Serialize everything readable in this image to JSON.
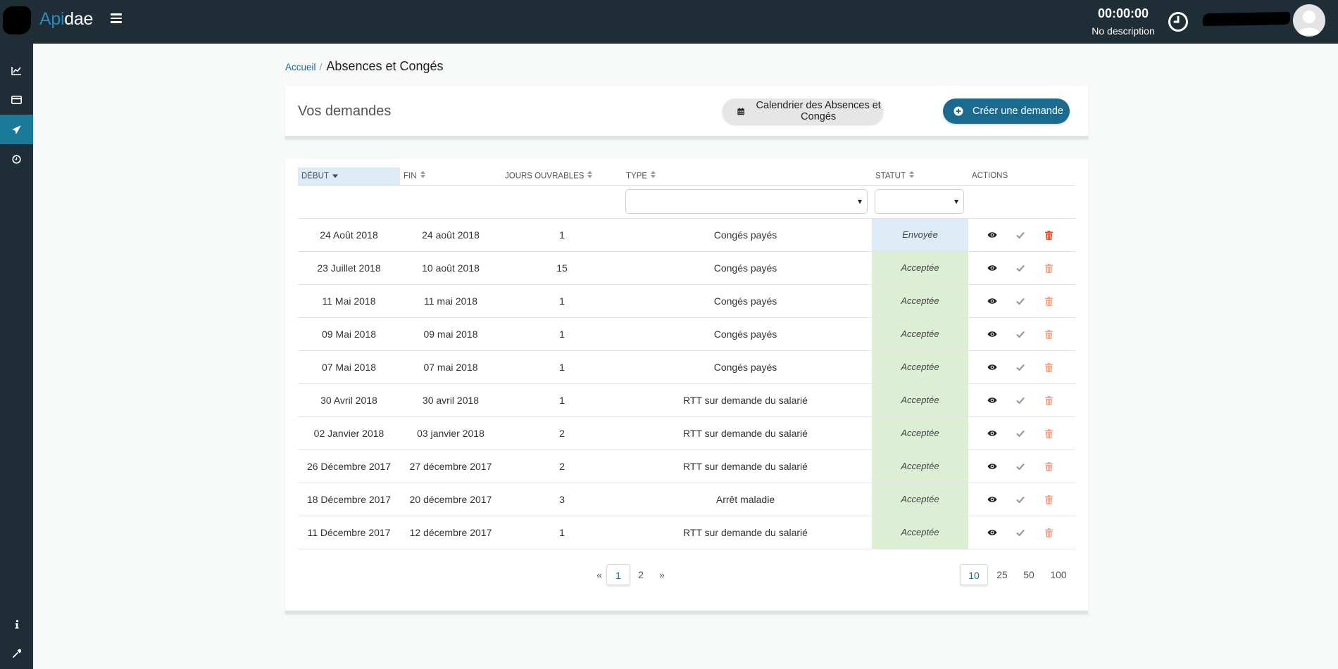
{
  "app": {
    "logo_part1": "Api",
    "logo_part2": "dae"
  },
  "topbar": {
    "timer": "00:00:00",
    "timer_desc": "No description"
  },
  "sidebar": {
    "items": [
      {
        "icon": "chart-line-icon"
      },
      {
        "icon": "credit-card-icon"
      },
      {
        "icon": "plane-icon",
        "active": true
      },
      {
        "icon": "clock-icon"
      }
    ],
    "bottom": [
      {
        "icon": "info-icon"
      },
      {
        "icon": "eyedropper-icon"
      }
    ]
  },
  "breadcrumb": {
    "home": "Accueil",
    "current": "Absences et Congés"
  },
  "header": {
    "title": "Vos demandes",
    "calendar_button": "Calendrier des Absences et Congés",
    "create_button": "Créer une demande"
  },
  "table": {
    "columns": {
      "debut": "Début",
      "fin": "Fin",
      "jours": "Jours ouvrables",
      "type": "Type",
      "statut": "Statut",
      "actions": "Actions"
    },
    "rows": [
      {
        "debut": "24 Août 2018",
        "fin": "24 août 2018",
        "jours": "1",
        "type": "Congés payés",
        "statut": "Envoyée",
        "status_class": "envoyee"
      },
      {
        "debut": "23 Juillet 2018",
        "fin": "10 août 2018",
        "jours": "15",
        "type": "Congés payés",
        "statut": "Acceptée",
        "status_class": "acceptee"
      },
      {
        "debut": "11 Mai 2018",
        "fin": "11 mai 2018",
        "jours": "1",
        "type": "Congés payés",
        "statut": "Acceptée",
        "status_class": "acceptee"
      },
      {
        "debut": "09 Mai 2018",
        "fin": "09 mai 2018",
        "jours": "1",
        "type": "Congés payés",
        "statut": "Acceptée",
        "status_class": "acceptee"
      },
      {
        "debut": "07 Mai 2018",
        "fin": "07 mai 2018",
        "jours": "1",
        "type": "Congés payés",
        "statut": "Acceptée",
        "status_class": "acceptee"
      },
      {
        "debut": "30 Avril 2018",
        "fin": "30 avril 2018",
        "jours": "1",
        "type": "RTT sur demande du salarié",
        "statut": "Acceptée",
        "status_class": "acceptee"
      },
      {
        "debut": "02 Janvier 2018",
        "fin": "03 janvier 2018",
        "jours": "2",
        "type": "RTT sur demande du salarié",
        "statut": "Acceptée",
        "status_class": "acceptee"
      },
      {
        "debut": "26 Décembre 2017",
        "fin": "27 décembre 2017",
        "jours": "2",
        "type": "RTT sur demande du salarié",
        "statut": "Acceptée",
        "status_class": "acceptee"
      },
      {
        "debut": "18 Décembre 2017",
        "fin": "20 décembre 2017",
        "jours": "3",
        "type": "Arrêt maladie",
        "statut": "Acceptée",
        "status_class": "acceptee"
      },
      {
        "debut": "11 Décembre 2017",
        "fin": "12 décembre 2017",
        "jours": "1",
        "type": "RTT sur demande du salarié",
        "statut": "Acceptée",
        "status_class": "acceptee"
      }
    ]
  },
  "pagination": {
    "prev": "«",
    "pages": [
      "1",
      "2"
    ],
    "current": "1",
    "next": "»",
    "page_sizes": [
      "10",
      "25",
      "50",
      "100"
    ],
    "current_size": "10"
  },
  "colors": {
    "topbar": "#1e2d36",
    "accent": "#1b6b8f",
    "sorted_header": "#dcebf5",
    "status_sent": "#dcebf5",
    "status_accepted": "#dcefd5",
    "delete_active": "#e0522a",
    "delete_faded": "#f2a58d"
  }
}
